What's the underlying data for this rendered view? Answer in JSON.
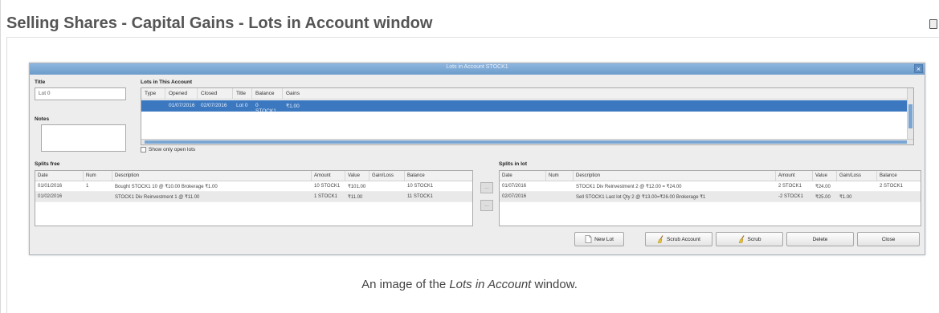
{
  "heading": "Selling Shares - Capital Gains - Lots in Account window",
  "window": {
    "title": "Lots in Account STOCK1",
    "close_symbol": "×"
  },
  "left_panel": {
    "title_label": "Title",
    "title_value": "Lot 0",
    "notes_label": "Notes",
    "notes_value": ""
  },
  "lots": {
    "label": "Lots in This Account",
    "columns": [
      "Type",
      "Opened",
      "Closed",
      "Title",
      "Balance",
      "Gains"
    ],
    "rows": [
      {
        "type": "",
        "opened": "01/07/2016",
        "closed": "02/07/2016",
        "title": "Lot 0",
        "balance": "0 STOCK1",
        "gains": "₹1.00"
      }
    ]
  },
  "show_open_lots": {
    "label": "Show only open lots",
    "checked": false
  },
  "splits_free": {
    "label": "Splits free",
    "columns": [
      "Date",
      "Num",
      "Description",
      "Amount",
      "Value",
      "Gain/Loss",
      "Balance"
    ],
    "rows": [
      {
        "date": "01/01/2016",
        "num": "1",
        "description": "Bought STOCK1 10 @ ₹10.00 Brokerage ₹1.00",
        "amount": "10 STOCK1",
        "value": "₹101.00",
        "gain": "",
        "balance": "10 STOCK1"
      },
      {
        "date": "01/02/2016",
        "num": "",
        "description": "STOCK1 Div Reinvestment 1 @ ₹11.00",
        "amount": "1 STOCK1",
        "value": "₹11.00",
        "gain": "",
        "balance": "11 STOCK1"
      }
    ]
  },
  "splits_in_lot": {
    "label": "Splits in lot",
    "columns": [
      "Date",
      "Num",
      "Description",
      "Amount",
      "Value",
      "Gain/Loss",
      "Balance"
    ],
    "rows": [
      {
        "date": "01/07/2016",
        "num": "",
        "description": "STOCK1 Div Reinvestment 2 @ ₹12.00 = ₹24.00",
        "amount": "2 STOCK1",
        "value": "₹24.00",
        "gain": "",
        "balance": "2 STOCK1"
      },
      {
        "date": "02/07/2016",
        "num": "",
        "description": "Sell STOCK1 Last lot Qty 2 @ ₹13.00=₹26.00 Brokerage ₹1",
        "amount": "-2 STOCK1",
        "value": "₹25.00",
        "gain": "₹1.00",
        "balance": ""
      }
    ]
  },
  "move_buttons": {
    "symbol": "..."
  },
  "buttons": {
    "new_lot": "New Lot",
    "scrub_account": "Scrub Account",
    "scrub": "Scrub",
    "delete": "Delete",
    "close": "Close"
  },
  "caption": {
    "prefix": "An image of the ",
    "emphasis": "Lots in Account",
    "suffix": " window."
  }
}
